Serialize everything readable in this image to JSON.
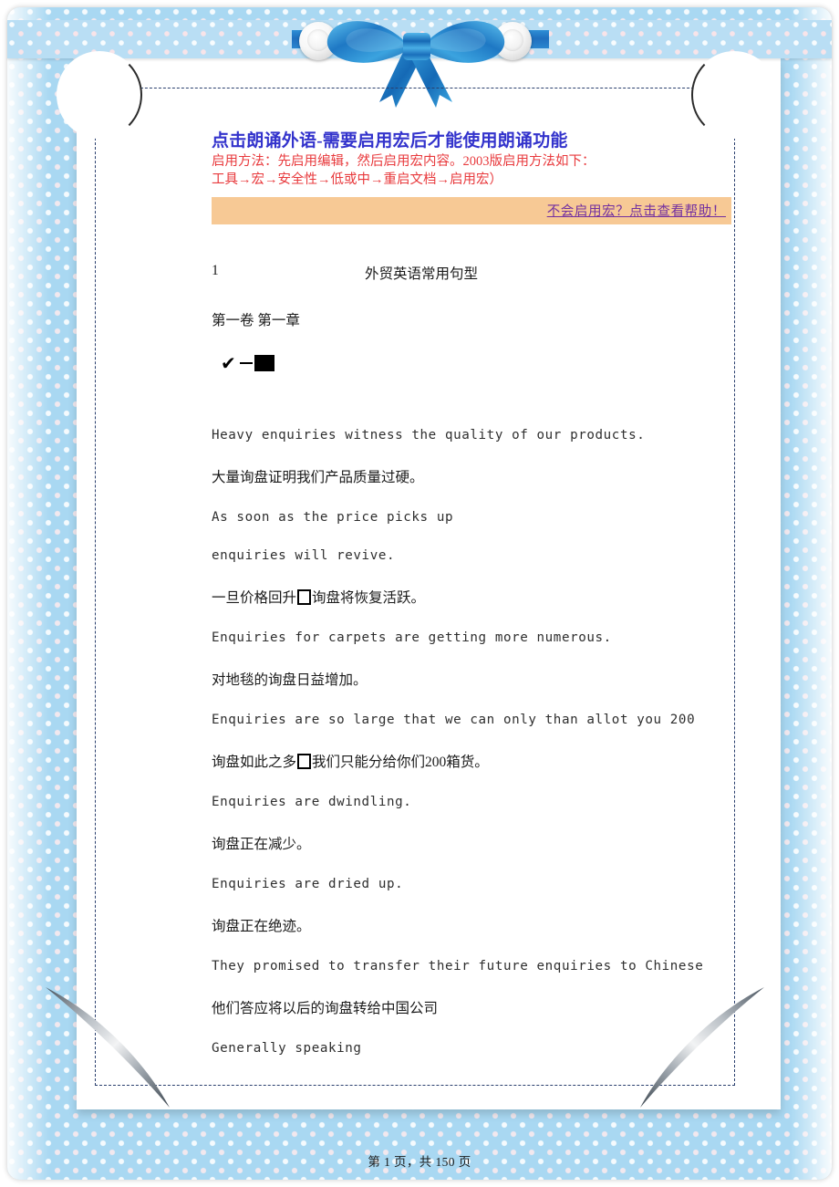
{
  "macro_notice": {
    "title": "点击朗诵外语-需要启用宏后才能使用朗诵功能",
    "note_line1": "启用方法：先启用编辑，然后启用宏内容。2003版启用方法如下：",
    "note_line2": "工具→宏→安全性→低或中→重启文档→启用宏）",
    "help_link": "不会启用宏？点击查看帮助！",
    "title_color": "#3333cc",
    "note_color": "#e8393c",
    "bar_color": "#f7c995",
    "link_color": "#7230a0"
  },
  "document": {
    "page_number_label": "1",
    "doc_title": "外贸英语常用句型",
    "chapter": "第一卷 第一章",
    "marker_glyphs": {
      "check": "✔",
      "dash": "—",
      "box": "■"
    },
    "lines": [
      {
        "lang": "en",
        "text": "Heavy enquiries witness the quality of our products."
      },
      {
        "lang": "zh",
        "text": "大量询盘证明我们产品质量过硬。"
      },
      {
        "lang": "en",
        "text": "As soon as the price picks up"
      },
      {
        "lang": "en",
        "text": "enquiries will revive."
      },
      {
        "lang": "zh",
        "text": "一旦价格回升",
        "tofu": true,
        "text2": "询盘将恢复活跃。"
      },
      {
        "lang": "en",
        "text": "Enquiries for carpets are getting more numerous."
      },
      {
        "lang": "zh",
        "text": "对地毯的询盘日益增加。"
      },
      {
        "lang": "en",
        "text": "Enquiries are so large that we can only than allot you 200"
      },
      {
        "lang": "zh",
        "text": "询盘如此之多",
        "tofu": true,
        "text2": "我们只能分给你们200箱货。"
      },
      {
        "lang": "en",
        "text": "Enquiries are dwindling."
      },
      {
        "lang": "zh",
        "text": "询盘正在减少。"
      },
      {
        "lang": "en",
        "text": "Enquiries are dried up."
      },
      {
        "lang": "zh",
        "text": "询盘正在绝迹。"
      },
      {
        "lang": "en",
        "text": "They promised to transfer their future enquiries to Chinese"
      },
      {
        "lang": "zh",
        "text": "他们答应将以后的询盘转给中国公司"
      },
      {
        "lang": "en",
        "text": "Generally speaking"
      }
    ]
  },
  "footer": {
    "page_status": "第 1 页，共 150 页"
  },
  "decoration": {
    "background_color": "#a9d8f2",
    "dot_color_white": "#ffffff",
    "dot_color_pink": "#ffebee",
    "ribbon_color": "#1f6fbe",
    "ribbon_highlight": "#4fb3e8",
    "pearl_color": "#f2f2f2",
    "swoosh_color": "#8f98a0",
    "border_style": "dashed",
    "border_color": "#2a3f6e"
  }
}
